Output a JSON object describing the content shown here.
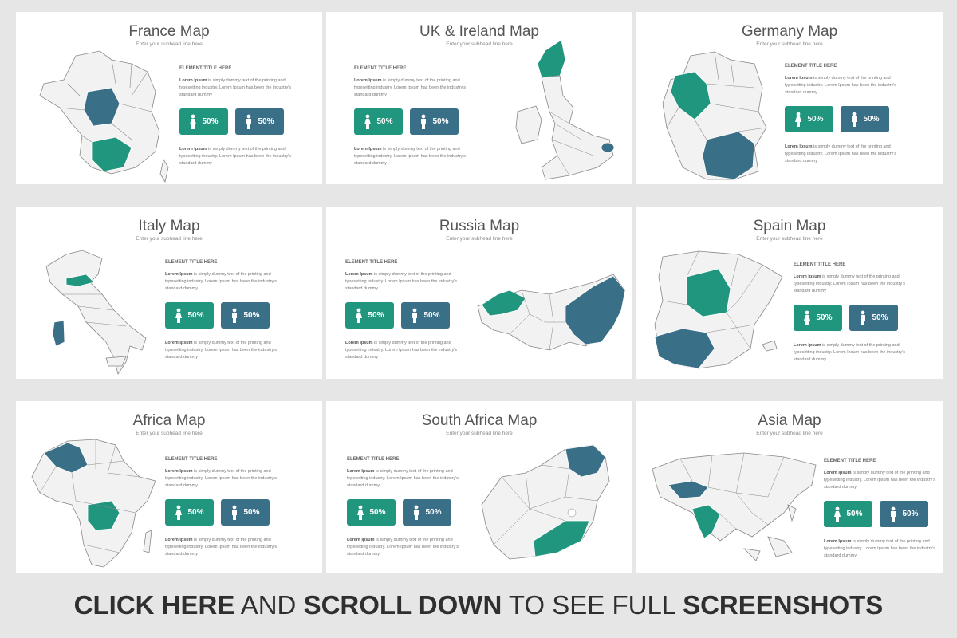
{
  "colors": {
    "accent_green": "#20967e",
    "accent_blue": "#3a6f88",
    "map_fill": "#f2f2f2",
    "map_stroke": "#888888"
  },
  "common": {
    "subhead": "Enter your subhead line here",
    "element_title": "ELEMENT TITLE HERE",
    "desc_bold": "Lorem Ipsum",
    "desc_rest": " is simply dummy text of the printing and typesetting industry. Lorem Ipsum has been the industry's standard dummy",
    "female_pct": "50%",
    "male_pct": "50%"
  },
  "slides": [
    {
      "title": "France Map"
    },
    {
      "title": "UK & Ireland Map"
    },
    {
      "title": "Germany Map"
    },
    {
      "title": "Italy Map"
    },
    {
      "title": "Russia Map"
    },
    {
      "title": "Spain Map"
    },
    {
      "title": "Africa Map"
    },
    {
      "title": "South Africa Map"
    },
    {
      "title": "Asia Map"
    }
  ],
  "footer": {
    "part1": "CLICK HERE",
    "part2": " AND ",
    "part3": "SCROLL DOWN",
    "part4": " TO SEE FULL ",
    "part5": "SCREENSHOTS"
  }
}
